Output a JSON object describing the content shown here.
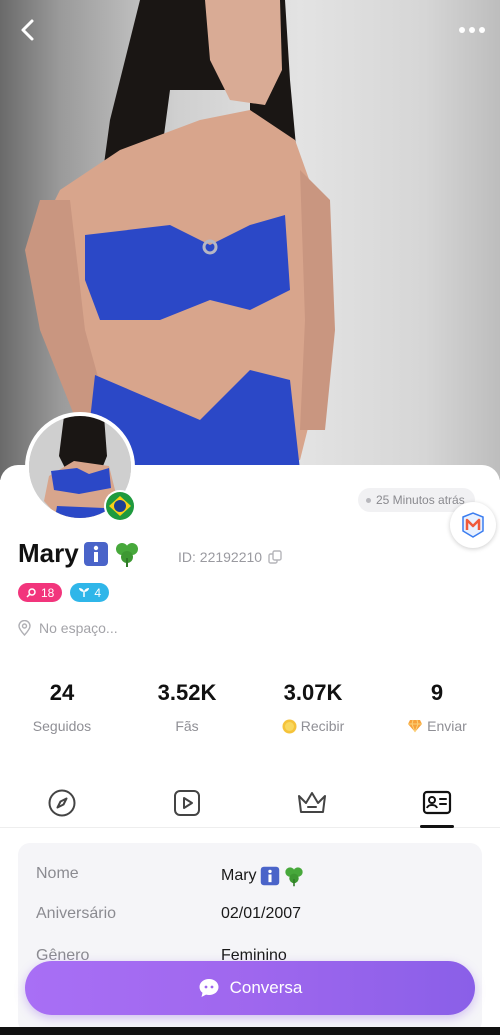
{
  "profile": {
    "name": "Mary",
    "id_label": "ID: 22192210",
    "last_seen": "25 Minutos atrás",
    "location": "No espaço...",
    "badges": {
      "level": "18",
      "plant": "4"
    }
  },
  "stats": [
    {
      "value": "24",
      "label": "Seguidos"
    },
    {
      "value": "3.52K",
      "label": "Fãs"
    },
    {
      "value": "3.07K",
      "label": "Recibir"
    },
    {
      "value": "9",
      "label": "Enviar"
    }
  ],
  "tabs": [
    {
      "icon": "compass-icon"
    },
    {
      "icon": "video-icon"
    },
    {
      "icon": "crown-icon"
    },
    {
      "icon": "profile-card-icon",
      "active": true
    }
  ],
  "info": [
    {
      "key": "Nome",
      "value": "Mary"
    },
    {
      "key": "Aniversário",
      "value": "02/01/2007"
    },
    {
      "key": "Gênero",
      "value": "Feminino"
    }
  ],
  "actions": {
    "chat_label": "Conversa"
  },
  "colors": {
    "accent": "#9f67ee",
    "badge_pink": "#f2357c",
    "badge_cyan": "#2fb6e9"
  }
}
